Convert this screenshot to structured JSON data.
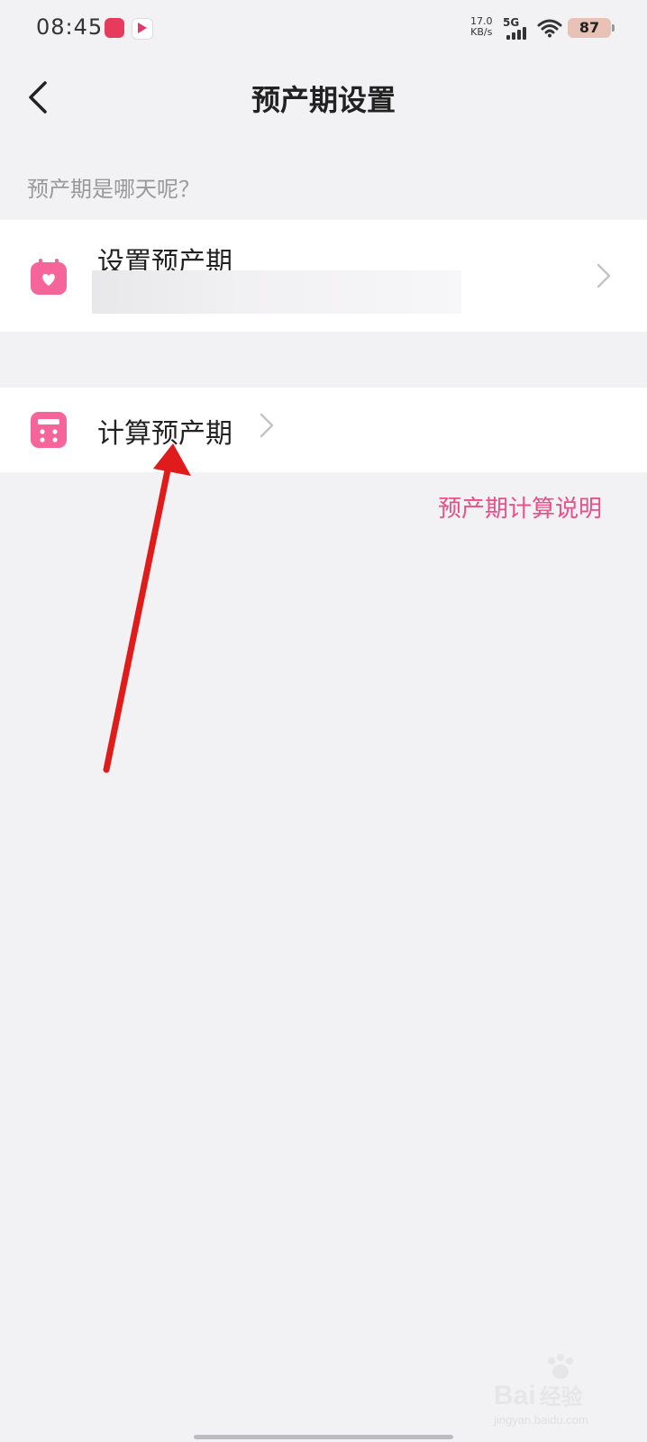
{
  "status_bar": {
    "time": "08:45",
    "net_speed": "17.0",
    "net_unit": "KB/s",
    "network": "5G",
    "battery": "87"
  },
  "nav": {
    "title": "预产期设置",
    "back_icon": "chevron-left-icon"
  },
  "section_hint": "预产期是哪天呢？",
  "rows": {
    "set_due_date": {
      "label": "设置预产期",
      "icon": "calendar-heart-icon"
    },
    "calc_due_date": {
      "label": "计算预产期",
      "icon": "calculator-icon"
    }
  },
  "explain_link": "预产期计算说明",
  "watermark": {
    "brand": "Bai",
    "brand_cn": "经验",
    "url": "jingyan.baidu.com"
  },
  "colors": {
    "accent": "#ea4f86",
    "background": "#f2f1f4",
    "annotation_arrow": "#e01b1b"
  }
}
